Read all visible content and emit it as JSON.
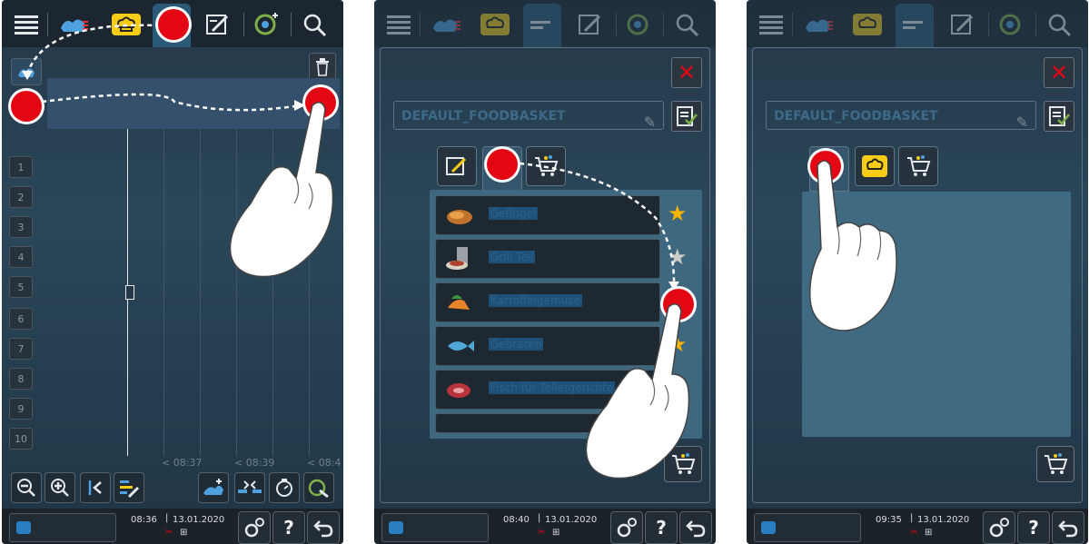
{
  "panels": [
    {
      "time": "08:36",
      "date": "13.01.2020",
      "lanes": [
        "1",
        "2",
        "3",
        "4",
        "5",
        "6",
        "7",
        "8",
        "9",
        "10"
      ],
      "time_labels": [
        "< 08:37",
        "< 08:39",
        "< 08:4"
      ],
      "footer": {
        "help_label": "?",
        "back_icon": "back-arrow-icon",
        "settings_icon": "gear-icon"
      }
    },
    {
      "time": "08:40",
      "date": "13.01.2020",
      "name_field": "DEFAULT_FOODBASKET",
      "list_items": [
        {
          "label": "Geflügel",
          "starred": true
        },
        {
          "label": "Grill Teil",
          "starred": false
        },
        {
          "label": "Kartoffelgemüse",
          "starred": true
        },
        {
          "label": "Gebraten",
          "starred": true
        },
        {
          "label": "Fisch für Tellergerichte",
          "starred": true
        }
      ]
    },
    {
      "time": "09:35",
      "date": "13.01.2020",
      "name_field": "DEFAULT_FOODBASKET"
    }
  ],
  "colors": {
    "accent_red": "#e30613",
    "star_yellow": "#f4b400",
    "panel_bg": "#2a4759"
  }
}
